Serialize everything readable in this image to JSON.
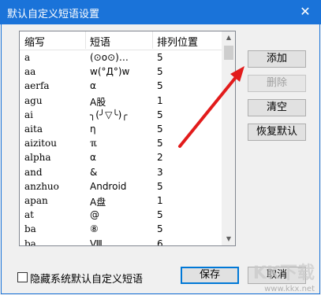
{
  "window": {
    "title": "默认自定义短语设置",
    "close_glyph": "✕"
  },
  "columns": [
    "缩写",
    "短语",
    "排列位置"
  ],
  "rows": [
    {
      "abbr": "a",
      "phrase": "(⊙o⊙)…",
      "pos": "5"
    },
    {
      "abbr": "aa",
      "phrase": "w(°Д°)w",
      "pos": "5"
    },
    {
      "abbr": "aerfa",
      "phrase": "α",
      "pos": "5"
    },
    {
      "abbr": "agu",
      "phrase": "A股",
      "pos": "1"
    },
    {
      "abbr": "ai",
      "phrase": "╮(╯▽╰)╭",
      "pos": "5"
    },
    {
      "abbr": "aita",
      "phrase": "η",
      "pos": "5"
    },
    {
      "abbr": "aizitou",
      "phrase": "ℼ",
      "pos": "5"
    },
    {
      "abbr": "alpha",
      "phrase": "α",
      "pos": "2"
    },
    {
      "abbr": "and",
      "phrase": "&",
      "pos": "3"
    },
    {
      "abbr": "anzhuo",
      "phrase": "Android",
      "pos": "5"
    },
    {
      "abbr": "apan",
      "phrase": "A盘",
      "pos": "1"
    },
    {
      "abbr": "at",
      "phrase": "@",
      "pos": "5"
    },
    {
      "abbr": "ba",
      "phrase": "⑧",
      "pos": "5"
    },
    {
      "abbr": "ba",
      "phrase": "Ⅷ",
      "pos": "6"
    }
  ],
  "buttons": {
    "add": "添加",
    "delete": "删除",
    "clear": "清空",
    "restore": "恢复默认",
    "save": "保存",
    "cancel": "取消"
  },
  "checkbox": {
    "label": "隐藏系统默认自定义短语",
    "checked": false
  },
  "watermark": {
    "logo": "KK下载",
    "url": "www.kkx.net"
  },
  "colors": {
    "titlebar": "#1a73d9",
    "arrow": "#e21b1b",
    "focus_border": "#0078d7"
  }
}
